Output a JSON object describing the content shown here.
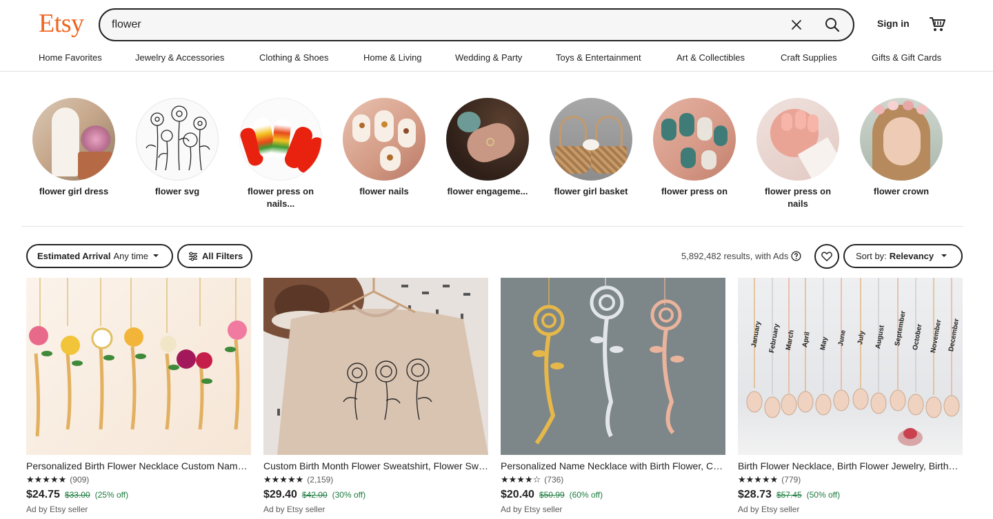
{
  "header": {
    "logo": "Etsy",
    "search_value": "flower",
    "signin_label": "Sign in"
  },
  "nav": [
    "Home Favorites",
    "Jewelry & Accessories",
    "Clothing & Shoes",
    "Home & Living",
    "Wedding & Party",
    "Toys & Entertainment",
    "Art & Collectibles",
    "Craft Supplies",
    "Gifts & Gift Cards"
  ],
  "categories": [
    {
      "label": "flower girl dress"
    },
    {
      "label": "flower svg"
    },
    {
      "label": "flower press on nails..."
    },
    {
      "label": "flower nails"
    },
    {
      "label": "flower engageme..."
    },
    {
      "label": "flower girl basket"
    },
    {
      "label": "flower press on"
    },
    {
      "label": "flower press on nails"
    },
    {
      "label": "flower crown"
    }
  ],
  "filters": {
    "arrival_label": "Estimated Arrival",
    "arrival_value": "Any time",
    "all_filters_label": "All Filters",
    "results_text": "5,892,482 results, with Ads",
    "sort_label": "Sort by:",
    "sort_value": "Relevancy"
  },
  "listings": [
    {
      "title": "Personalized Birth Flower Necklace Custom Name Necklace",
      "stars": "★★★★★",
      "reviews": "(909)",
      "price": "$24.75",
      "original_price": "$33.00",
      "discount": "(25% off)",
      "ad_text": "Ad by Etsy seller"
    },
    {
      "title": "Custom Birth Month Flower Sweatshirt, Flower Sweatshirt",
      "stars": "★★★★★",
      "reviews": "(2,159)",
      "price": "$29.40",
      "original_price": "$42.00",
      "discount": "(30% off)",
      "ad_text": "Ad by Etsy seller"
    },
    {
      "title": "Personalized Name Necklace with Birth Flower, Custom Necklace",
      "stars": "★★★★☆",
      "reviews": "(736)",
      "price": "$20.40",
      "original_price": "$50.99",
      "discount": "(60% off)",
      "ad_text": "Ad by Etsy seller"
    },
    {
      "title": "Birth Flower Necklace, Birth Flower Jewelry, Birthday Gift",
      "stars": "★★★★★",
      "reviews": "(779)",
      "price": "$28.73",
      "original_price": "$57.45",
      "discount": "(50% off)",
      "ad_text": "Ad by Etsy seller"
    }
  ],
  "months": [
    "January",
    "February",
    "March",
    "April",
    "May",
    "June",
    "July",
    "August",
    "September",
    "October",
    "November",
    "December"
  ],
  "colors": {
    "brand": "#f1641e",
    "sale": "#1b7a3d"
  }
}
